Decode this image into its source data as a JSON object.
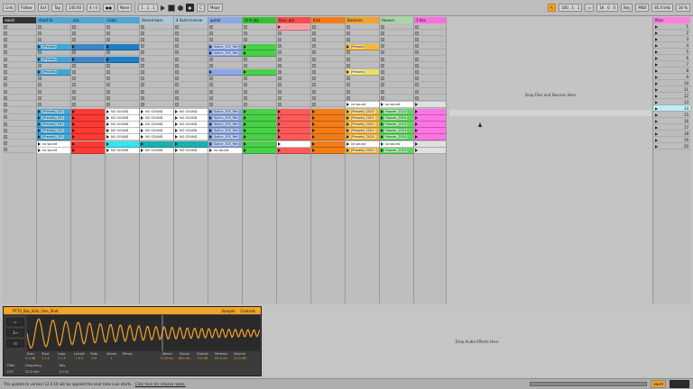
{
  "control_bar": {
    "link_label": "Link",
    "follow_label": "Follow",
    "ext_label": "Ext",
    "tap_label": "Tap",
    "tempo": "140.00",
    "time_sig": "4 / 4",
    "metro_label": "None",
    "bar_pos": "1 . 1 . 1",
    "key_label": "C",
    "scale_label": "Major",
    "pos": "4 . 1 . 1",
    "loop_len": "100 . 1 . 1",
    "loop_end": "16 . 0 . 0",
    "key_map": "Key",
    "midi_map": "MIDI",
    "cpu_label": "85.0 kHz",
    "cpu_pct": "16 %"
  },
  "tracks": [
    {
      "name": "swish",
      "color": "#333333",
      "text_color": "#eeeeee",
      "clips": []
    },
    {
      "name": "short fx",
      "color": "#4ea6d6",
      "clips": [
        {
          "row": 4,
          "label": "[Presets]",
          "color": "#3ea6dd"
        },
        {
          "row": 6,
          "label": "[Presets]",
          "color": "#3ea6dd"
        },
        {
          "row": 8,
          "label": "[Presets]",
          "color": "#3ea6dd"
        },
        {
          "row": 14,
          "label": "[Presets] 201",
          "color": "#3ea6dd"
        },
        {
          "row": 15,
          "label": "[Presets] 201",
          "color": "#3ea6dd"
        },
        {
          "row": 16,
          "label": "[Presets] 201",
          "color": "#3ea6dd"
        },
        {
          "row": 17,
          "label": "[Presets] 201",
          "color": "#3ea6dd"
        },
        {
          "row": 18,
          "label": "[Presets] 201",
          "color": "#3ea6dd"
        },
        {
          "row": 19,
          "label": "no sound",
          "color": "#ffffff"
        },
        {
          "row": 20,
          "label": "no sound",
          "color": "#ffffff"
        }
      ]
    },
    {
      "name": "arp",
      "color": "#4ea6d6",
      "clips": [
        {
          "row": 4,
          "label": "",
          "color": "#3e86c6"
        },
        {
          "row": 6,
          "label": "",
          "color": "#3e86c6"
        },
        {
          "row": 14,
          "label": "",
          "color": "#ff3a32"
        },
        {
          "row": 15,
          "label": "",
          "color": "#ff3a32"
        },
        {
          "row": 16,
          "label": "",
          "color": "#ff3a32"
        },
        {
          "row": 17,
          "label": "",
          "color": "#ff3a32"
        },
        {
          "row": 18,
          "label": "",
          "color": "#ff3a32"
        },
        {
          "row": 19,
          "label": "",
          "color": "#ff3a32"
        },
        {
          "row": 20,
          "label": "",
          "color": "#ff3a32"
        }
      ]
    },
    {
      "name": "Lead",
      "color": "#4ea6d6",
      "clips": [
        {
          "row": 4,
          "label": "",
          "color": "#1a7fc7"
        },
        {
          "row": 6,
          "label": "",
          "color": "#1a7fc7"
        },
        {
          "row": 14,
          "label": "NO SOUND",
          "color": "#ffffff"
        },
        {
          "row": 15,
          "label": "NO SOUND",
          "color": "#ffffff"
        },
        {
          "row": 16,
          "label": "NO SOUND",
          "color": "#ffffff"
        },
        {
          "row": 17,
          "label": "NO SOUND",
          "color": "#ffffff"
        },
        {
          "row": 18,
          "label": "NO SOUND",
          "color": "#ffffff"
        },
        {
          "row": 19,
          "label": "",
          "color": "#33e6f0"
        },
        {
          "row": 20,
          "label": "NO SOUND",
          "color": "#ffffff"
        }
      ]
    },
    {
      "name": "Stored bass",
      "color": "#a9c7da",
      "clips": [
        {
          "row": 14,
          "label": "NO SOUND",
          "color": "#ffffff"
        },
        {
          "row": 15,
          "label": "NO SOUND",
          "color": "#ffffff"
        },
        {
          "row": 16,
          "label": "NO SOUND",
          "color": "#ffffff"
        },
        {
          "row": 17,
          "label": "NO SOUND",
          "color": "#ffffff"
        },
        {
          "row": 18,
          "label": "NO SOUND",
          "color": "#ffffff"
        },
        {
          "row": 19,
          "label": "",
          "color": "#1ab0b0"
        },
        {
          "row": 20,
          "label": "NO SOUND",
          "color": "#ffffff"
        }
      ]
    },
    {
      "name": "4 Saint trancer",
      "color": "#a9c7da",
      "clips": [
        {
          "row": 14,
          "label": "NO SOUND",
          "color": "#ffffff"
        },
        {
          "row": 15,
          "label": "NO SOUND",
          "color": "#ffffff"
        },
        {
          "row": 16,
          "label": "NO SOUND",
          "color": "#ffffff"
        },
        {
          "row": 17,
          "label": "NO SOUND",
          "color": "#ffffff"
        },
        {
          "row": 18,
          "label": "NO SOUND",
          "color": "#ffffff"
        },
        {
          "row": 19,
          "label": "",
          "color": "#1ab0b0"
        },
        {
          "row": 20,
          "label": "NO SOUND",
          "color": "#ffffff"
        }
      ]
    },
    {
      "name": "guitar",
      "color": "#8aa7e6",
      "clips": [
        {
          "row": 4,
          "label": "Splice_303_Ret",
          "color": "#8aa7e6"
        },
        {
          "row": 5,
          "label": "Splice_303_Ret",
          "color": "#8aa7e6"
        },
        {
          "row": 8,
          "label": "",
          "color": "#8aa7e6"
        },
        {
          "row": 14,
          "label": "Splice_303_Ret",
          "color": "#8aa7e6"
        },
        {
          "row": 15,
          "label": "Splice_303_Ret",
          "color": "#8aa7e6"
        },
        {
          "row": 16,
          "label": "Splice_303_Ret",
          "color": "#8aa7e6"
        },
        {
          "row": 17,
          "label": "Splice_303_Ret",
          "color": "#8aa7e6"
        },
        {
          "row": 18,
          "label": "Splice_303_Ret",
          "color": "#8aa7e6"
        },
        {
          "row": 19,
          "label": "Splice_303_Ret",
          "color": "#8aa7e6"
        },
        {
          "row": 20,
          "label": "no sound",
          "color": "#ffffff"
        }
      ]
    },
    {
      "name": "Drill gtp",
      "color": "#33c233",
      "clips": [
        {
          "row": 4,
          "label": "",
          "color": "#46d146"
        },
        {
          "row": 5,
          "label": "",
          "color": "#46d146"
        },
        {
          "row": 8,
          "label": "",
          "color": "#46d146"
        },
        {
          "row": 14,
          "label": "",
          "color": "#46d146"
        },
        {
          "row": 15,
          "label": "",
          "color": "#46d146"
        },
        {
          "row": 16,
          "label": "",
          "color": "#46d146"
        },
        {
          "row": 17,
          "label": "",
          "color": "#46d146"
        },
        {
          "row": 18,
          "label": "",
          "color": "#46d146"
        },
        {
          "row": 19,
          "label": "",
          "color": "#46d146"
        },
        {
          "row": 20,
          "label": "",
          "color": "#46d146"
        }
      ]
    },
    {
      "name": "Bass gtp",
      "color": "#ff4a4a",
      "clips": [
        {
          "row": 1,
          "label": "",
          "color": "#ff9aa2"
        },
        {
          "row": 14,
          "label": "",
          "color": "#ff5a5a"
        },
        {
          "row": 15,
          "label": "",
          "color": "#ff5a5a"
        },
        {
          "row": 16,
          "label": "",
          "color": "#ff5a5a"
        },
        {
          "row": 17,
          "label": "",
          "color": "#ff5a5a"
        },
        {
          "row": 18,
          "label": "",
          "color": "#ff5a5a"
        },
        {
          "row": 19,
          "label": "",
          "color": "#ffffff"
        },
        {
          "row": 20,
          "label": "",
          "color": "#ff5a5a"
        }
      ]
    },
    {
      "name": "Kick",
      "color": "#f47c16",
      "clips": [
        {
          "row": 14,
          "label": "",
          "color": "#f47c16"
        },
        {
          "row": 15,
          "label": "",
          "color": "#f47c16"
        },
        {
          "row": 16,
          "label": "",
          "color": "#f47c16"
        },
        {
          "row": 17,
          "label": "",
          "color": "#f47c16"
        },
        {
          "row": 18,
          "label": "",
          "color": "#f47c16"
        },
        {
          "row": 19,
          "label": "",
          "color": "#f47c16"
        },
        {
          "row": 20,
          "label": "",
          "color": "#f47c16"
        }
      ]
    },
    {
      "name": "Bassline",
      "color": "#f3a329",
      "clips": [
        {
          "row": 4,
          "label": "[Presets]",
          "color": "#f5b73a"
        },
        {
          "row": 8,
          "label": "[Presets]",
          "color": "#e8e06a"
        },
        {
          "row": 13,
          "label": "no sound",
          "color": "#ffffff"
        },
        {
          "row": 14,
          "label": "[Presets] 2024",
          "color": "#f5b73a"
        },
        {
          "row": 15,
          "label": "[Presets] 2024",
          "color": "#f5b73a"
        },
        {
          "row": 16,
          "label": "[Presets] 2024",
          "color": "#f5b73a"
        },
        {
          "row": 17,
          "label": "[Presets] 2024",
          "color": "#f5b73a"
        },
        {
          "row": 18,
          "label": "[Presets] 2024",
          "color": "#f5b73a"
        },
        {
          "row": 19,
          "label": "no sound",
          "color": "#ffffff"
        },
        {
          "row": 20,
          "label": "[Presets] 2024",
          "color": "#f5b73a"
        }
      ]
    },
    {
      "name": "Hoover",
      "color": "#a7d6a7",
      "clips": [
        {
          "row": 13,
          "label": "no sound",
          "color": "#ffffff"
        },
        {
          "row": 14,
          "label": "Hoover_2024",
          "color": "#5fd85f"
        },
        {
          "row": 15,
          "label": "Hoover_2024",
          "color": "#5fd85f"
        },
        {
          "row": 16,
          "label": "Hoover_2024",
          "color": "#5fd85f"
        },
        {
          "row": 17,
          "label": "Hoover_2024",
          "color": "#5fd85f"
        },
        {
          "row": 18,
          "label": "Hoover_2024",
          "color": "#5fd85f"
        },
        {
          "row": 19,
          "label": "no sound",
          "color": "#ffffff"
        },
        {
          "row": 20,
          "label": "Hoover_2024",
          "color": "#5fd85f"
        }
      ]
    },
    {
      "name": "1-Vox",
      "color": "#ff6ee0",
      "clips": [
        {
          "row": 13,
          "label": "",
          "color": "#e0e0e0"
        },
        {
          "row": 14,
          "label": "",
          "color": "#ff74e4"
        },
        {
          "row": 15,
          "label": "",
          "color": "#ff74e4"
        },
        {
          "row": 16,
          "label": "",
          "color": "#ff74e4"
        },
        {
          "row": 17,
          "label": "",
          "color": "#ff74e4"
        },
        {
          "row": 18,
          "label": "",
          "color": "#ff74e4"
        },
        {
          "row": 19,
          "label": "",
          "color": "#e0e0e0"
        },
        {
          "row": 20,
          "label": "",
          "color": "#e0e0e0"
        }
      ]
    }
  ],
  "master": {
    "name": "Main",
    "scenes": [
      "1",
      "2",
      "3",
      "4",
      "5",
      "6",
      "7",
      "8",
      "9",
      "10",
      "11",
      "12",
      "13",
      "14",
      "15",
      "16",
      "17",
      "18",
      "19",
      "20"
    ],
    "selected_scene": "14"
  },
  "drop_files_text": "Drop Files and Devices Here",
  "drop_effects_text": "Drop Audio Effects Here",
  "clip_view": {
    "clip_name": "PT74_Bas_Kick_One_Shot",
    "sample_label": "Sample",
    "controls_label": "Controls",
    "params": [
      {
        "label": "Gain",
        "value": "0.0 dB"
      },
      {
        "label": "Start",
        "value": "1.1.1"
      },
      {
        "label": "Loop",
        "value": "1.1.1"
      },
      {
        "label": "Length",
        "value": "1.0.0"
      },
      {
        "label": "Fade",
        "value": "0.0"
      },
      {
        "label": "Voices",
        "value": "1"
      },
      {
        "label": "Retrig",
        "value": ""
      },
      {
        "label": "Attack",
        "value": "0.00 ms"
      },
      {
        "label": "Decay",
        "value": "600 ms"
      },
      {
        "label": "Sustain",
        "value": "0.0 dB"
      },
      {
        "label": "Release",
        "value": "50.0 ms"
      },
      {
        "label": "Volume",
        "value": "-12.0 dB"
      }
    ],
    "filter_label": "Filter",
    "lfo_label": "LFO",
    "frequency_label": "Frequency",
    "res_label": "Res",
    "frequency_value": "22.0 kHz",
    "res_value": "0.0 %"
  },
  "status": {
    "message": "The update to version 12.0.10 will be applied the next time Live starts.",
    "link_text": "Click here for release notes.",
    "track_name": "swish"
  }
}
